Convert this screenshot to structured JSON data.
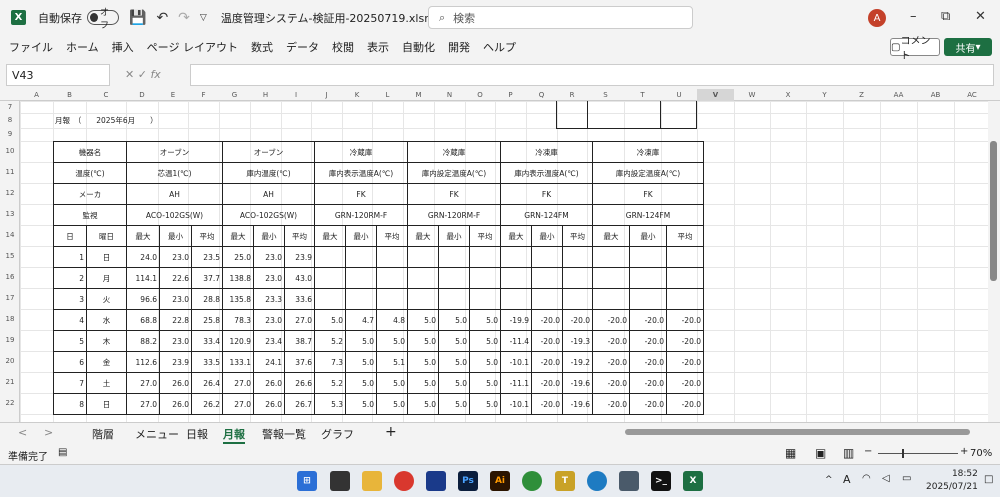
{
  "titlebar": {
    "autosave_label": "自動保存",
    "autosave_state": "オフ",
    "filename": "温度管理システム-検証用-20250719.xlsm  -",
    "search_placeholder": "検索",
    "avatar_initial": "A"
  },
  "menu": [
    "ファイル",
    "ホーム",
    "挿入",
    "ページ レイアウト",
    "数式",
    "データ",
    "校閲",
    "表示",
    "自動化",
    "開発",
    "ヘルプ"
  ],
  "comment_label": "コメント",
  "share_label": "共有",
  "namebox": "V43",
  "columns": [
    "A",
    "B",
    "C",
    "D",
    "E",
    "F",
    "G",
    "H",
    "I",
    "J",
    "K",
    "L",
    "M",
    "N",
    "O",
    "P",
    "Q",
    "R",
    "S",
    "T",
    "U",
    "V",
    "W",
    "X",
    "Y",
    "Z",
    "AA",
    "AB",
    "AC"
  ],
  "rows": [
    "7",
    "8",
    "9",
    "10",
    "11",
    "12",
    "13",
    "14",
    "15",
    "16",
    "17",
    "18",
    "19",
    "20",
    "21",
    "22"
  ],
  "sheet": {
    "month_label": "月報　（　　2025年6月　　）",
    "header": {
      "machine_label": "機器名",
      "temp_label": "温度(℃)",
      "maker_label": "メーカ",
      "monitor_label": "監視",
      "day_label": "日",
      "weekday_label": "曜日",
      "groups": [
        {
          "machine": "オーブン",
          "temp": "芯温1(℃)",
          "maker": "AH",
          "model": "ACO-102GS(W)"
        },
        {
          "machine": "オーブン",
          "temp": "庫内温度(℃)",
          "maker": "AH",
          "model": "ACO-102GS(W)"
        },
        {
          "machine": "冷蔵庫",
          "temp": "庫内表示温度A(℃)",
          "maker": "FK",
          "model": "GRN-120RM-F"
        },
        {
          "machine": "冷蔵庫",
          "temp": "庫内設定温度A(℃)",
          "maker": "FK",
          "model": "GRN-120RM-F"
        },
        {
          "machine": "冷凍庫",
          "temp": "庫内表示温度A(℃)",
          "maker": "FK",
          "model": "GRN-124FM"
        },
        {
          "machine": "冷凍庫",
          "temp": "庫内設定温度A(℃)",
          "maker": "FK",
          "model": "GRN-124FM"
        }
      ],
      "stat_labels": [
        "最大",
        "最小",
        "平均"
      ]
    },
    "data": [
      {
        "day": "1",
        "wd": "日",
        "v": [
          "24.0",
          "23.0",
          "23.5",
          "25.0",
          "23.0",
          "23.9",
          "",
          "",
          "",
          "",
          "",
          "",
          "",
          "",
          "",
          "",
          "",
          ""
        ]
      },
      {
        "day": "2",
        "wd": "月",
        "v": [
          "114.1",
          "22.6",
          "37.7",
          "138.8",
          "23.0",
          "43.0",
          "",
          "",
          "",
          "",
          "",
          "",
          "",
          "",
          "",
          "",
          "",
          ""
        ]
      },
      {
        "day": "3",
        "wd": "火",
        "v": [
          "96.6",
          "23.0",
          "28.8",
          "135.8",
          "23.3",
          "33.6",
          "",
          "",
          "",
          "",
          "",
          "",
          "",
          "",
          "",
          "",
          "",
          ""
        ]
      },
      {
        "day": "4",
        "wd": "水",
        "v": [
          "68.8",
          "22.8",
          "25.8",
          "78.3",
          "23.0",
          "27.0",
          "5.0",
          "4.7",
          "4.8",
          "5.0",
          "5.0",
          "5.0",
          "-19.9",
          "-20.0",
          "-20.0",
          "-20.0",
          "-20.0",
          "-20.0"
        ]
      },
      {
        "day": "5",
        "wd": "木",
        "v": [
          "88.2",
          "23.0",
          "33.4",
          "120.9",
          "23.4",
          "38.7",
          "5.2",
          "5.0",
          "5.0",
          "5.0",
          "5.0",
          "5.0",
          "-11.4",
          "-20.0",
          "-19.3",
          "-20.0",
          "-20.0",
          "-20.0"
        ]
      },
      {
        "day": "6",
        "wd": "金",
        "v": [
          "112.6",
          "23.9",
          "33.5",
          "133.1",
          "24.1",
          "37.6",
          "7.3",
          "5.0",
          "5.1",
          "5.0",
          "5.0",
          "5.0",
          "-10.1",
          "-20.0",
          "-19.2",
          "-20.0",
          "-20.0",
          "-20.0"
        ]
      },
      {
        "day": "7",
        "wd": "土",
        "v": [
          "27.0",
          "26.0",
          "26.4",
          "27.0",
          "26.0",
          "26.6",
          "5.2",
          "5.0",
          "5.0",
          "5.0",
          "5.0",
          "5.0",
          "-11.1",
          "-20.0",
          "-19.6",
          "-20.0",
          "-20.0",
          "-20.0"
        ]
      },
      {
        "day": "8",
        "wd": "日",
        "v": [
          "27.0",
          "26.0",
          "26.2",
          "27.0",
          "26.0",
          "26.7",
          "5.3",
          "5.0",
          "5.0",
          "5.0",
          "5.0",
          "5.0",
          "-10.1",
          "-20.0",
          "-19.6",
          "-20.0",
          "-20.0",
          "-20.0"
        ]
      }
    ]
  },
  "tabs": [
    "階層",
    "メニュー",
    "日報",
    "月報",
    "警報一覧",
    "グラフ"
  ],
  "active_tab": "月報",
  "status": {
    "ready": "準備完了",
    "zoom": "70%"
  },
  "taskbar": {
    "time": "18:52",
    "date": "2025/07/21"
  }
}
